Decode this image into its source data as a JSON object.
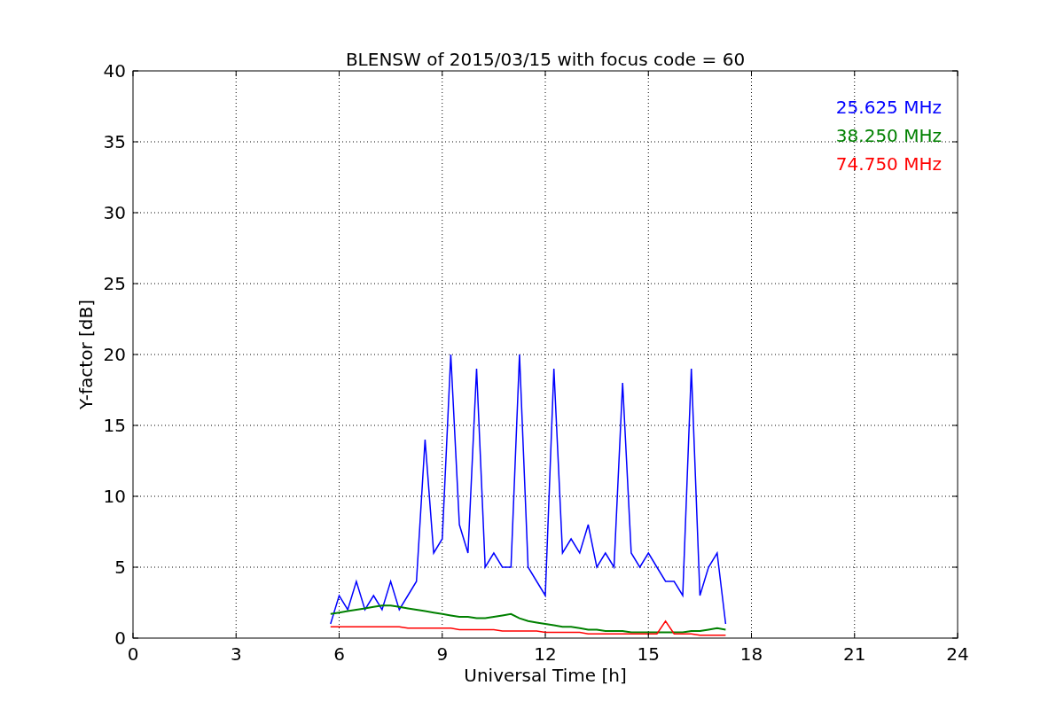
{
  "chart_data": {
    "type": "line",
    "title": "BLENSW of 2015/03/15 with focus code = 60",
    "xlabel": "Universal Time [h]",
    "ylabel": "Y-factor [dB]",
    "x": [
      5.75,
      6,
      6.25,
      6.5,
      6.75,
      7,
      7.25,
      7.5,
      7.75,
      8,
      8.25,
      8.5,
      8.75,
      9,
      9.25,
      9.5,
      9.75,
      10,
      10.25,
      10.5,
      10.75,
      11,
      11.25,
      11.5,
      11.75,
      12,
      12.25,
      12.5,
      12.75,
      13,
      13.25,
      13.5,
      13.75,
      14,
      14.25,
      14.5,
      14.75,
      15,
      15.25,
      15.5,
      15.75,
      16,
      16.25,
      16.5,
      16.75,
      17,
      17.25
    ],
    "series": [
      {
        "name": "25.625 MHz",
        "color": "#0000ff",
        "values": [
          1,
          3,
          2,
          4,
          2,
          3,
          2,
          4,
          2,
          3,
          4,
          14,
          6,
          7,
          20,
          8,
          6,
          19,
          5,
          6,
          5,
          5,
          20,
          5,
          4,
          3,
          19,
          6,
          7,
          6,
          8,
          5,
          6,
          5,
          18,
          6,
          5,
          6,
          5,
          4,
          4,
          3,
          19,
          3,
          5,
          6,
          1
        ]
      },
      {
        "name": "38.250 MHz",
        "color": "#008000",
        "values": [
          1.7,
          1.8,
          1.9,
          2.0,
          2.1,
          2.2,
          2.3,
          2.3,
          2.2,
          2.1,
          2.0,
          1.9,
          1.8,
          1.7,
          1.6,
          1.5,
          1.5,
          1.4,
          1.4,
          1.5,
          1.6,
          1.7,
          1.4,
          1.2,
          1.1,
          1.0,
          0.9,
          0.8,
          0.8,
          0.7,
          0.6,
          0.6,
          0.5,
          0.5,
          0.5,
          0.4,
          0.4,
          0.4,
          0.4,
          0.4,
          0.4,
          0.4,
          0.5,
          0.5,
          0.6,
          0.7,
          0.6
        ]
      },
      {
        "name": "74.750 MHz",
        "color": "#ff0000",
        "values": [
          0.8,
          0.8,
          0.8,
          0.8,
          0.8,
          0.8,
          0.8,
          0.8,
          0.8,
          0.7,
          0.7,
          0.7,
          0.7,
          0.7,
          0.7,
          0.6,
          0.6,
          0.6,
          0.6,
          0.6,
          0.5,
          0.5,
          0.5,
          0.5,
          0.5,
          0.4,
          0.4,
          0.4,
          0.4,
          0.4,
          0.3,
          0.3,
          0.3,
          0.3,
          0.3,
          0.3,
          0.3,
          0.3,
          0.3,
          1.2,
          0.3,
          0.3,
          0.3,
          0.2,
          0.2,
          0.2,
          0.2
        ]
      }
    ],
    "xlim": [
      0,
      24
    ],
    "ylim": [
      0,
      40
    ],
    "xticks": [
      0,
      3,
      6,
      9,
      12,
      15,
      18,
      21,
      24
    ],
    "yticks": [
      0,
      5,
      10,
      15,
      20,
      25,
      30,
      35,
      40
    ],
    "grid": true
  }
}
